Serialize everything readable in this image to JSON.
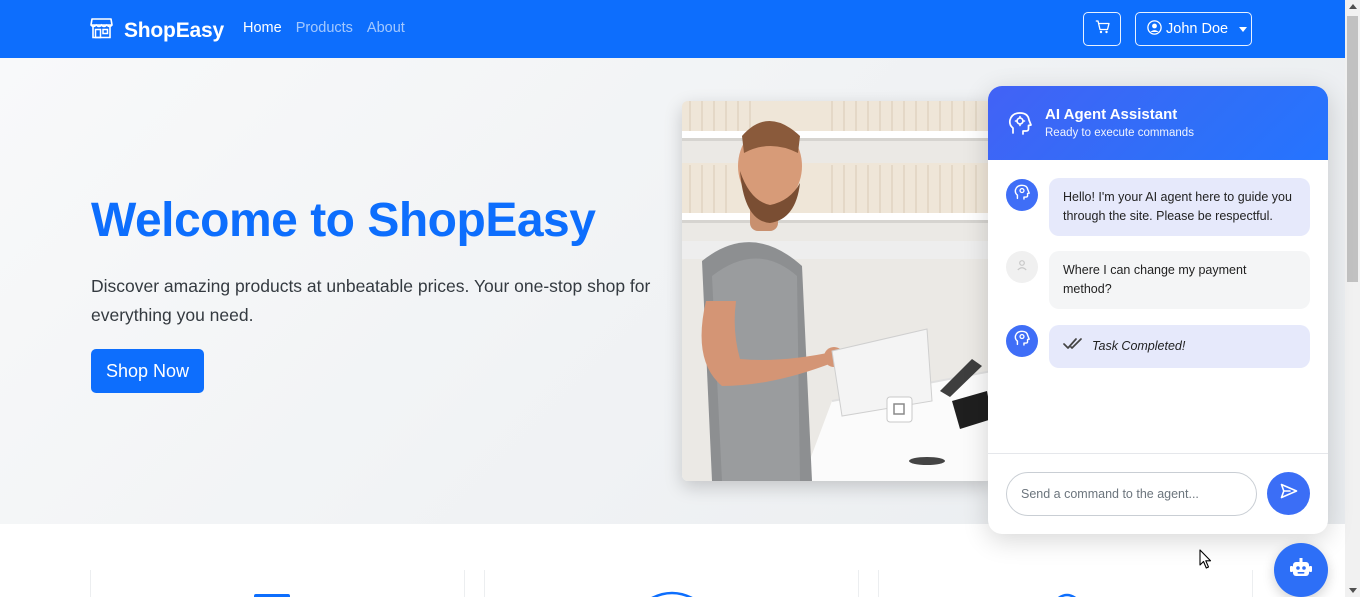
{
  "navbar": {
    "brand": "ShopEasy",
    "links": [
      {
        "label": "Home",
        "active": true
      },
      {
        "label": "Products",
        "active": false
      },
      {
        "label": "About",
        "active": false
      }
    ],
    "user_name": "John Doe",
    "icons": {
      "brand": "store-icon",
      "cart": "cart-icon",
      "user": "user-circle-icon"
    }
  },
  "hero": {
    "title": "Welcome to ShopEasy",
    "subtitle": "Discover amazing products at unbeatable prices. Your one-stop shop for everything you need.",
    "cta": "Shop Now"
  },
  "chat": {
    "title": "AI Agent Assistant",
    "status": "Ready to execute commands",
    "messages": [
      {
        "from": "agent",
        "text": "Hello! I'm your AI agent here to guide you through the site. Please be respectful."
      },
      {
        "from": "user",
        "text": "Where I can change my payment method?"
      },
      {
        "from": "agent",
        "text": "Task Completed!"
      }
    ],
    "input_placeholder": "Send a command to the agent...",
    "input_value": ""
  },
  "colors": {
    "primary": "#0d6efd",
    "chat_accent": "#3b6ef6",
    "agent_bubble": "#e6e9fb",
    "user_bubble": "#f4f5f6"
  }
}
